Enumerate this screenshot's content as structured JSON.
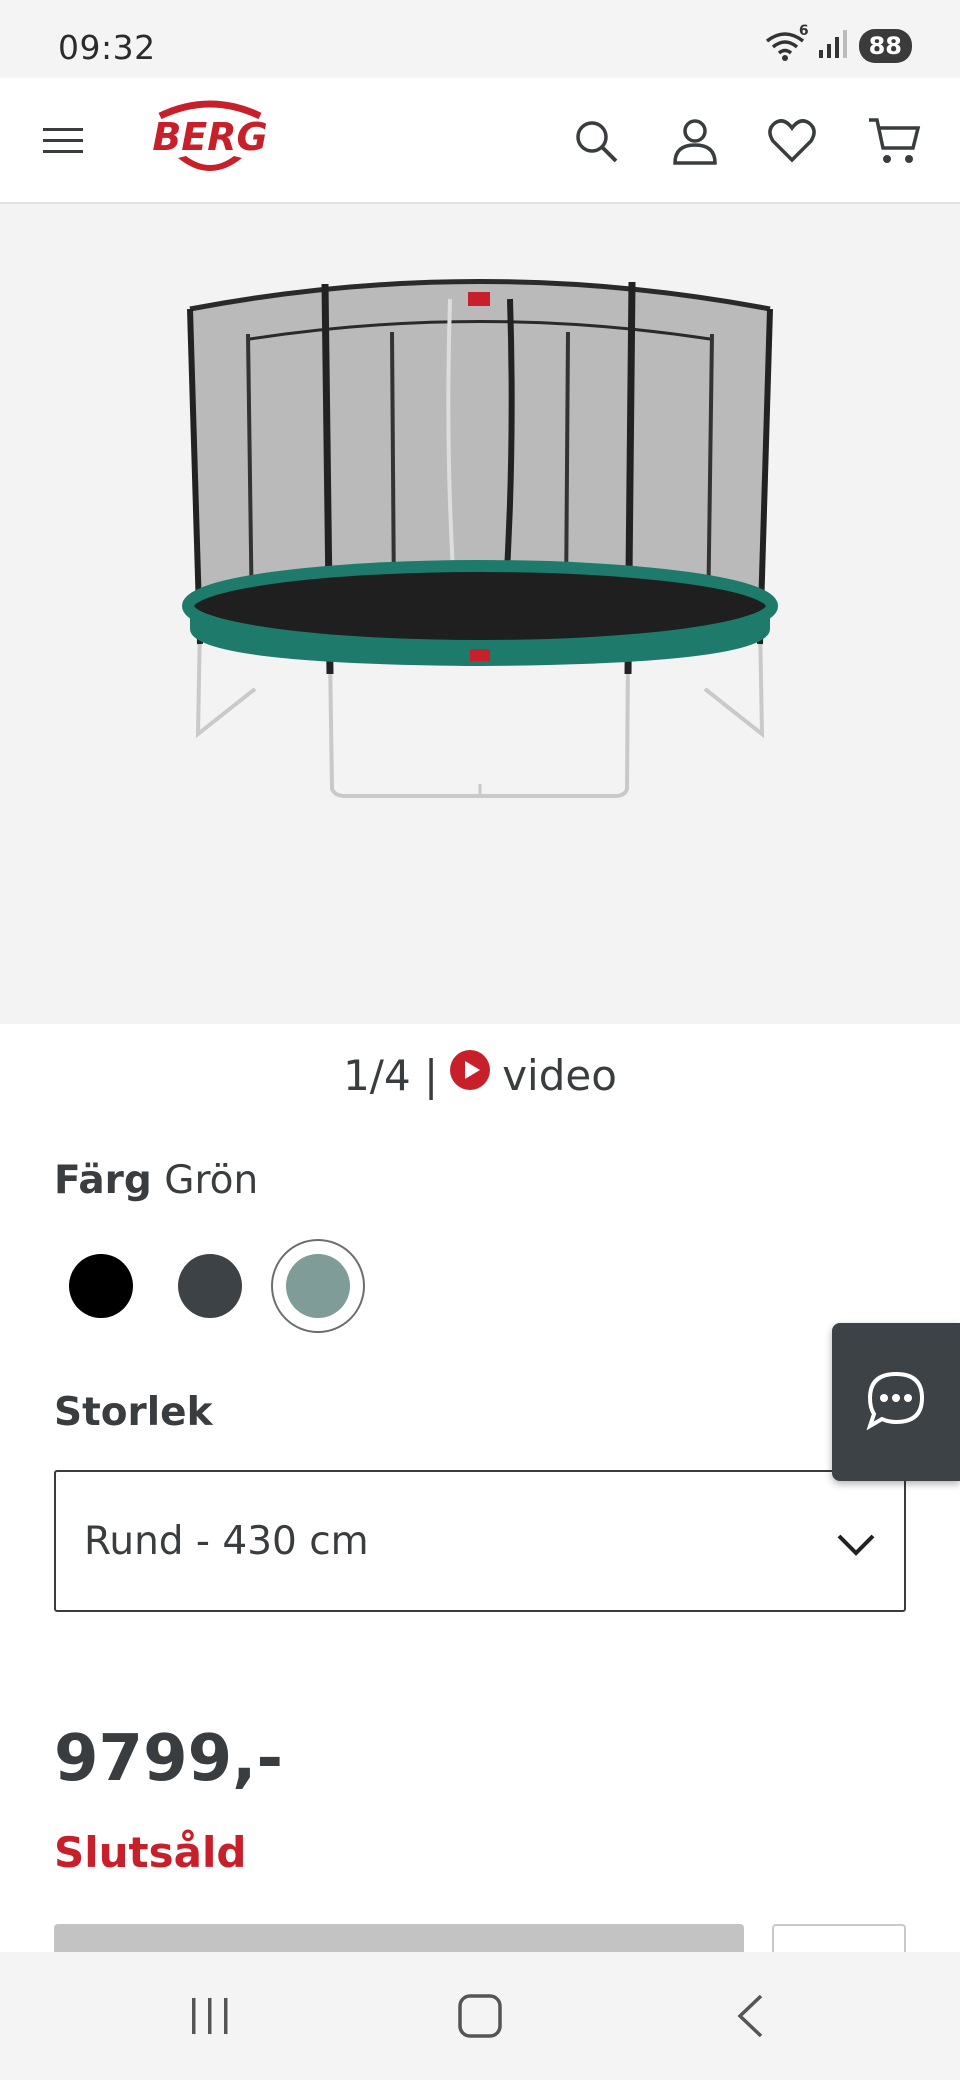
{
  "status_bar": {
    "time": "09:32",
    "battery": "88",
    "wifi_badge": "6"
  },
  "header": {
    "logo_text": "BERG",
    "icons": [
      "menu-icon",
      "search-icon",
      "account-icon",
      "heart-icon",
      "cart-icon"
    ]
  },
  "gallery": {
    "counter": "1/4 |",
    "video_label": "video"
  },
  "color": {
    "label": "Färg",
    "value": "Grön",
    "swatches": [
      "#000000",
      "#3d4246",
      "#7f9c98"
    ],
    "selected_index": 2
  },
  "size": {
    "label": "Storlek",
    "selected": "Rund - 430 cm"
  },
  "price": {
    "value": "9799,-",
    "status": "Slutsåld"
  },
  "colors": {
    "brand_red": "#c8202a",
    "text": "#3a3d40",
    "trampoline_green": "#1e7a6a"
  }
}
